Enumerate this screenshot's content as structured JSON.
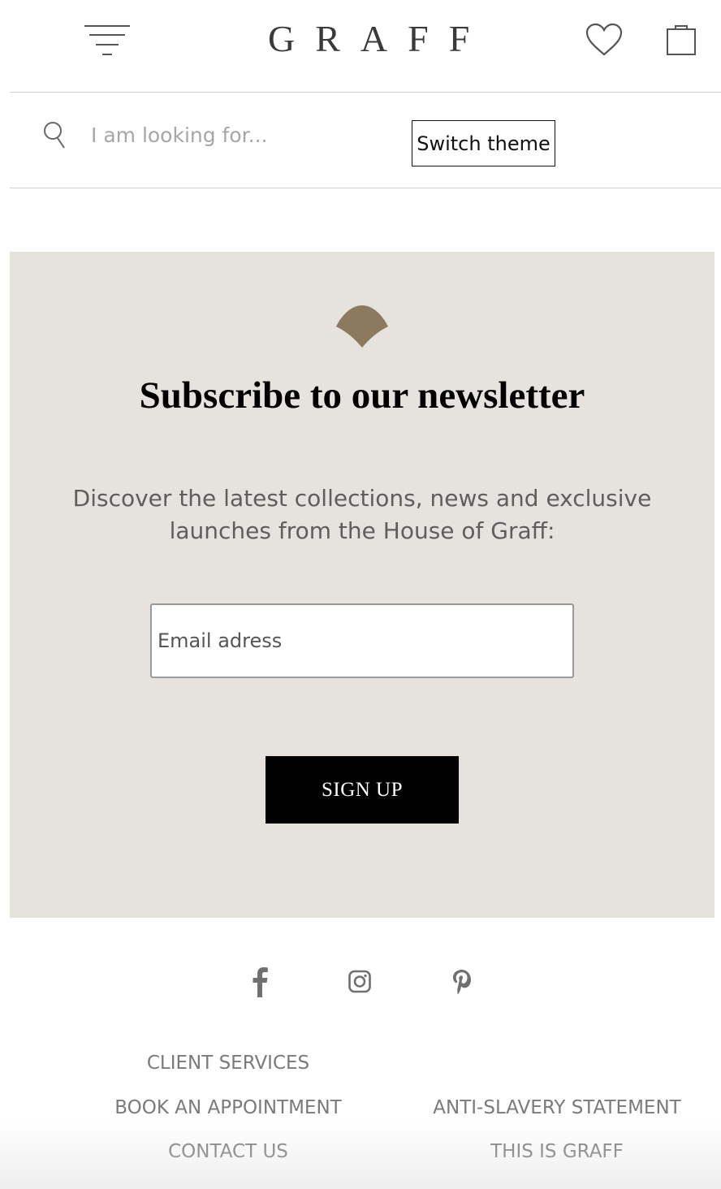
{
  "header": {
    "logo_text": "GRAFF",
    "icons": {
      "menu": "menu-icon",
      "wishlist": "heart-icon",
      "bag": "shopping-bag-icon"
    }
  },
  "search": {
    "placeholder": "I am looking for...",
    "value": "",
    "icon": "search-icon",
    "switch_theme_label": "Switch theme"
  },
  "newsletter": {
    "icon": "leaf-icon",
    "title": "Subscribe to our newsletter",
    "description": "Discover the latest collections, news and exclusive launches from the House of Graff:",
    "email_placeholder": "Email adress",
    "email_value": "",
    "signup_label": "SIGN UP",
    "colors": {
      "background": "#e6e3de",
      "accent": "#8c7a5e",
      "button": "#000000"
    }
  },
  "social": [
    {
      "name": "facebook-icon"
    },
    {
      "name": "instagram-icon"
    },
    {
      "name": "pinterest-icon"
    }
  ],
  "footer": {
    "left_links": [
      "CLIENT SERVICES",
      "BOOK AN APPOINTMENT",
      "CONTACT US"
    ],
    "right_links": [
      "ANTI-SLAVERY STATEMENT",
      "THIS IS GRAFF"
    ]
  }
}
